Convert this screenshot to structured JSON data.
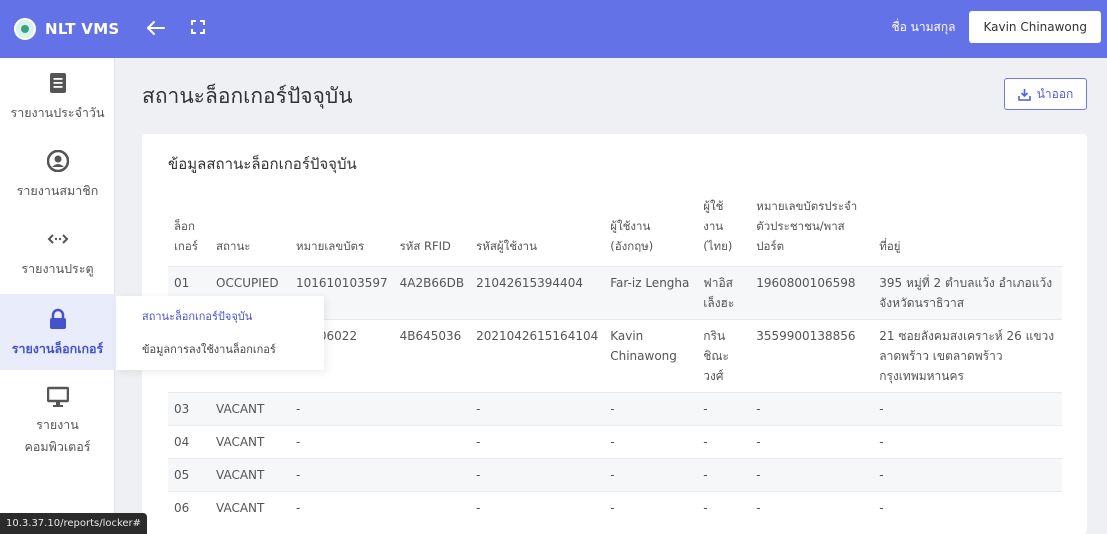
{
  "app": {
    "name": "NLT VMS",
    "user_label": "ชื่อ นามสกุล",
    "user_name": "Kavin Chinawong"
  },
  "sidebar": {
    "items": [
      {
        "label": "รายงานประจำวัน",
        "icon": "document-icon"
      },
      {
        "label": "รายงานสมาชิก",
        "icon": "user-circle-icon"
      },
      {
        "label": "รายงานประตู",
        "icon": "door-code-icon"
      },
      {
        "label": "รายงานล็อกเกอร์",
        "icon": "lock-icon"
      },
      {
        "label_line1": "รายงาน",
        "label_line2": "คอมพิวเตอร์",
        "icon": "monitor-icon"
      }
    ]
  },
  "submenu": {
    "items": [
      {
        "label": "สถานะล็อกเกอร์ปัจจุบัน"
      },
      {
        "label": "ข้อมูลการลงใช้งานล็อกเกอร์"
      }
    ]
  },
  "page": {
    "title": "สถานะล็อกเกอร์ปัจจุบัน",
    "export_label": "นำออก",
    "card_title": "ข้อมูลสถานะล็อกเกอร์ปัจจุบัน"
  },
  "table": {
    "headers": [
      "ล็อก\nเกอร์",
      "สถานะ",
      "หมายเลขบัตร",
      "รหัส RFID",
      "รหัสผู้ใช้งาน",
      "ผู้ใช้งาน\n(อังกฤษ)",
      "ผู้ใช้\nงาน\n(ไทย)",
      "หมายเลขบัตรประจำ\nตัวประชาชน/พาส\nปอร์ต",
      "ที่อยู่"
    ],
    "rows": [
      [
        "01",
        "OCCUPIED",
        "101610103597",
        "4A2B66DB",
        "21042615394404",
        "Far-iz Lengha",
        "ฟาอิส\nเล็งฮะ",
        "1960800106598",
        "395 หมู่ที่ 2 ตำบลแว้ง อำเภอแว้ง\nจังหวัดนราธิวาส"
      ],
      [
        "",
        "",
        "10106022",
        "4B645036",
        "2021042615164104",
        "Kavin\nChinawong",
        "กริน\nชิณะ\nวงศ์",
        "3559900138856",
        "21 ซอยลังคมสงเคราะห์ 26 แขวง\nลาดพร้าว เขตลาดพร้าว\nกรุงเทพมหานคร"
      ],
      [
        "03",
        "VACANT",
        "-",
        "",
        "-",
        "-",
        "-",
        "-",
        "-"
      ],
      [
        "04",
        "VACANT",
        "-",
        "",
        "-",
        "-",
        "-",
        "-",
        "-"
      ],
      [
        "05",
        "VACANT",
        "-",
        "",
        "-",
        "-",
        "-",
        "-",
        "-"
      ],
      [
        "06",
        "VACANT",
        "-",
        "",
        "-",
        "-",
        "-",
        "-",
        "-"
      ]
    ]
  },
  "status_bar": {
    "url": "10.3.37.10/reports/locker#"
  },
  "colors": {
    "topbar": "#6472e8",
    "accent": "#4453c9"
  }
}
